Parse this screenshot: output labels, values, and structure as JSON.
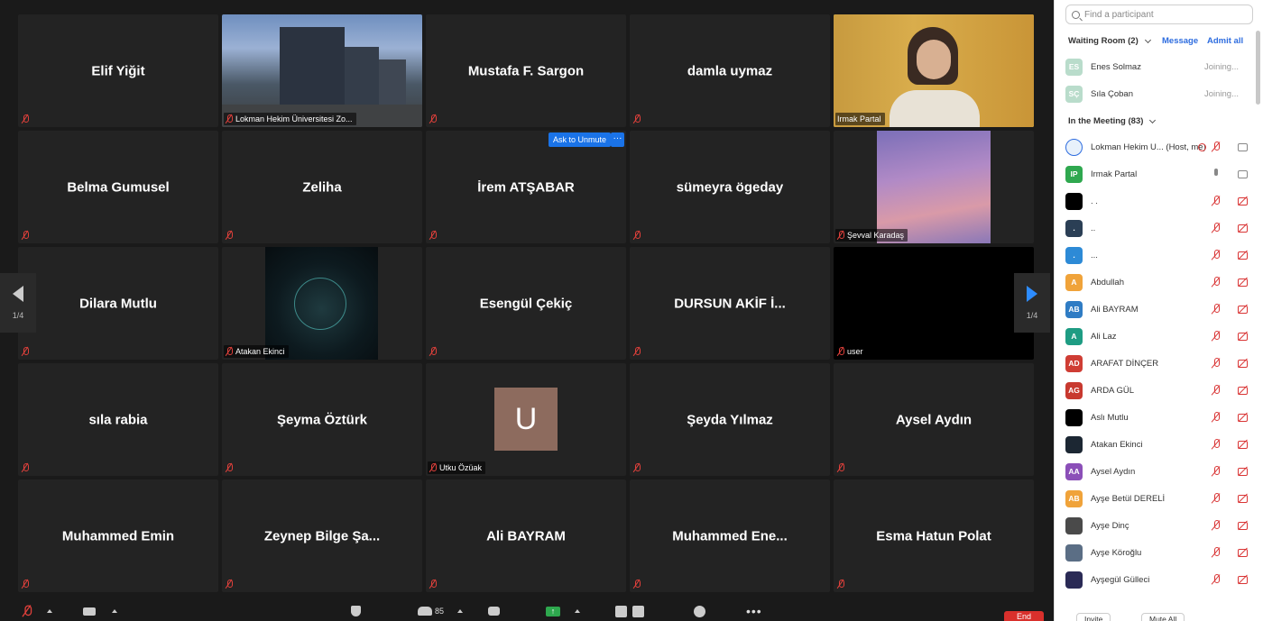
{
  "gallery": {
    "tiles": [
      {
        "name": "Elif Yiğit"
      },
      {
        "label": "Lokman Hekim Üniversitesi Zo..."
      },
      {
        "name": "Mustafa F. Sargon"
      },
      {
        "name": "damla uymaz"
      },
      {
        "label": "Irmak Partal"
      },
      {
        "name": "Belma Gumusel"
      },
      {
        "name": "Zeliha"
      },
      {
        "name": "İrem ATŞABAR"
      },
      {
        "name": "sümeyra ögeday"
      },
      {
        "label": "Şevval Karadaş"
      },
      {
        "name": "Dilara Mutlu"
      },
      {
        "label": "Atakan Ekinci"
      },
      {
        "name": "Esengül Çekiç"
      },
      {
        "name": "DURSUN  AKİF  İ..."
      },
      {
        "label": "user"
      },
      {
        "name": "sıla rabia"
      },
      {
        "name": "Şeyma Öztürk"
      },
      {
        "label": "Utku Özüak",
        "avatar_letter": "U"
      },
      {
        "name": "Şeyda Yılmaz"
      },
      {
        "name": "Aysel Aydın"
      },
      {
        "name": "Muhammed Emin"
      },
      {
        "name": "Zeynep  Bilge  Şa..."
      },
      {
        "name": "Ali BAYRAM"
      },
      {
        "name": "Muhammed  Ene..."
      },
      {
        "name": "Esma Hatun Polat"
      }
    ],
    "ask_unmute": "Ask to Unmute",
    "ask_more": "···",
    "page_left": "1/4",
    "page_right": "1/4"
  },
  "toolbar": {
    "participants_count": "85",
    "end_label": "End"
  },
  "panel": {
    "search_placeholder": "Find a participant",
    "waiting_room_label": "Waiting Room (2)",
    "message_label": "Message",
    "admit_all_label": "Admit all",
    "waiting": [
      {
        "initials": "ES",
        "name": "Enes Solmaz",
        "status": "Joining...",
        "color": "#b9dccb"
      },
      {
        "initials": "SÇ",
        "name": "Sıla Çoban",
        "status": "Joining...",
        "color": "#b9dccb"
      }
    ],
    "in_meeting_label": "In the Meeting (83)",
    "participants": [
      {
        "initials": "",
        "name": "Lokman Hekim U... (Host, me)",
        "color": "#e8f1fb",
        "icon": "logo"
      },
      {
        "initials": "IP",
        "name": "Irmak Partal",
        "color": "#2fa84f",
        "icon": "on"
      },
      {
        "initials": "",
        "name": ". .",
        "color": "#000000"
      },
      {
        "initials": ".",
        "name": "..",
        "color": "#2b3f55"
      },
      {
        "initials": ".",
        "name": "...",
        "color": "#2d8ad6"
      },
      {
        "initials": "A",
        "name": "Abdullah",
        "color": "#f0a33a"
      },
      {
        "initials": "AB",
        "name": "Ali BAYRAM",
        "color": "#2f7cc4"
      },
      {
        "initials": "A",
        "name": "Ali Laz",
        "color": "#1e9c83"
      },
      {
        "initials": "AD",
        "name": "ARAFAT DİNÇER",
        "color": "#cf3d34"
      },
      {
        "initials": "AG",
        "name": "ARDA GÜL",
        "color": "#c8392f"
      },
      {
        "initials": "",
        "name": "Aslı Mutlu",
        "color": "#000000"
      },
      {
        "initials": "",
        "name": "Atakan Ekinci",
        "color": "#1c2733"
      },
      {
        "initials": "AA",
        "name": "Aysel Aydın",
        "color": "#8b4fb8"
      },
      {
        "initials": "AB",
        "name": "Ayşe Betül DERELİ",
        "color": "#f0a33a"
      },
      {
        "initials": "",
        "name": "Ayşe Dinç",
        "color": "#4a4a4a"
      },
      {
        "initials": "",
        "name": "Ayşe Köroğlu",
        "color": "#5b6e85"
      },
      {
        "initials": "",
        "name": "Ayşegül Gülleci",
        "color": "#2a2a55"
      }
    ],
    "invite_label": "Invite",
    "mute_all_label": "Mute All"
  }
}
